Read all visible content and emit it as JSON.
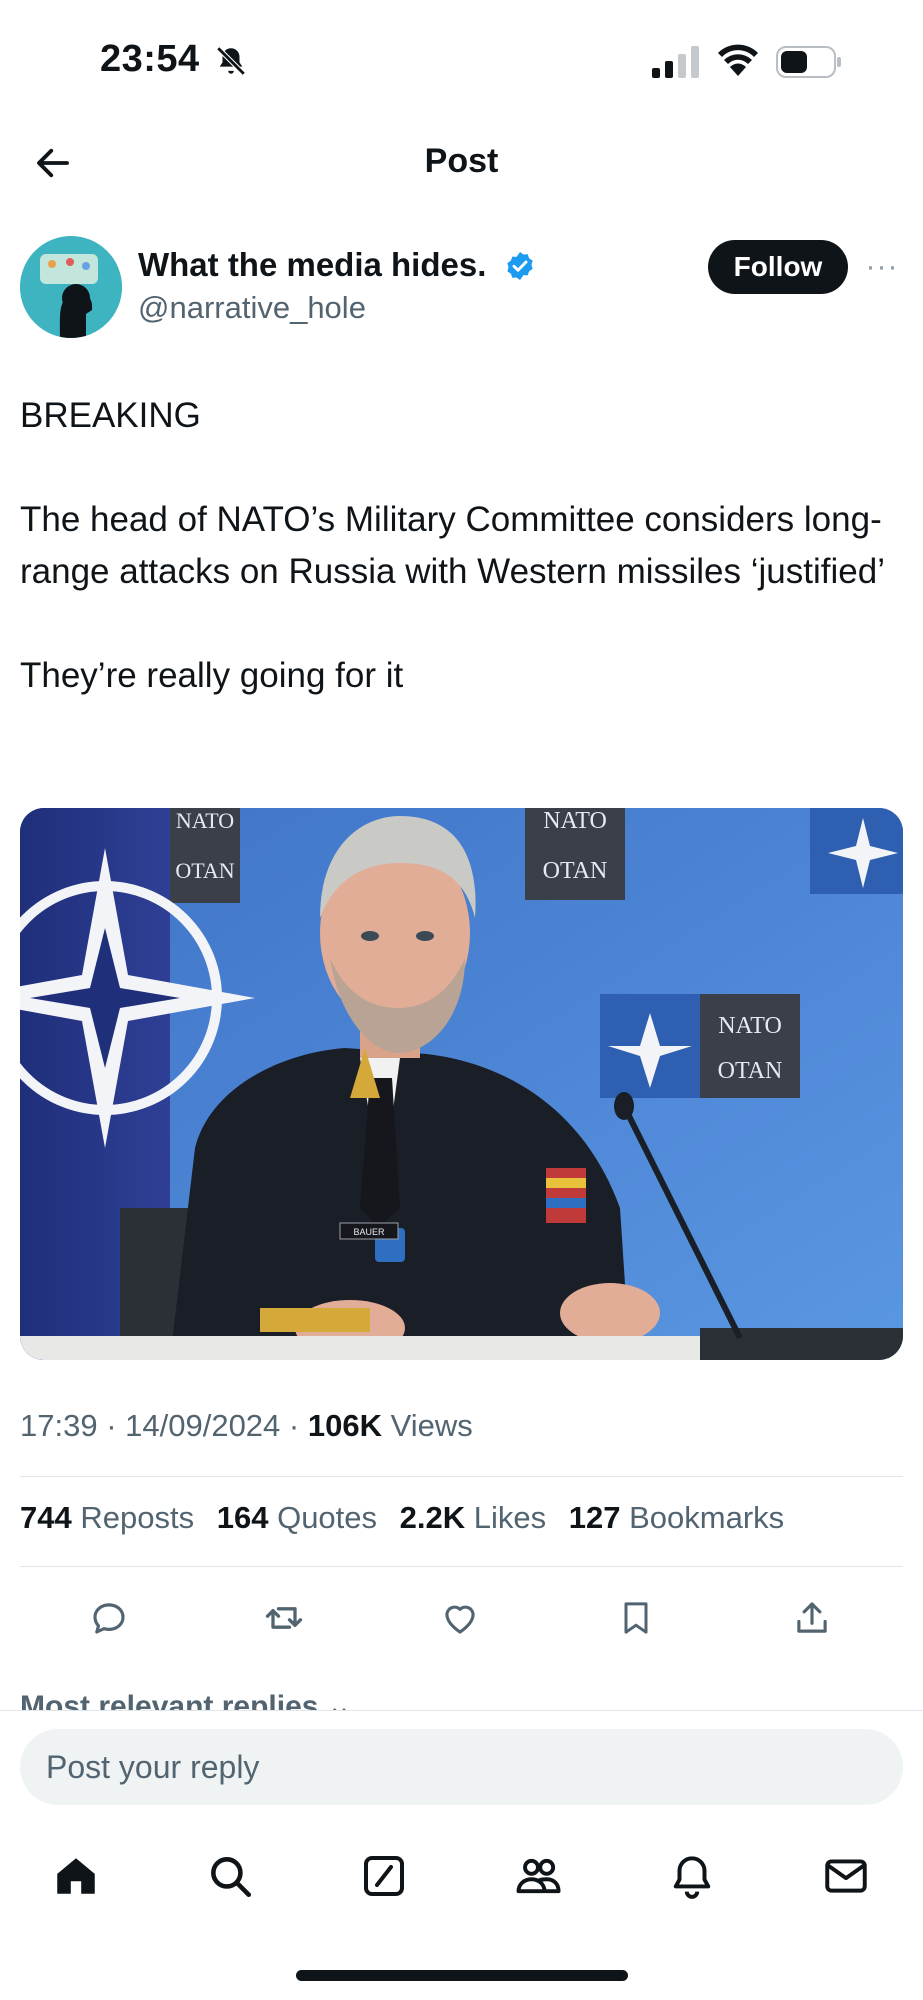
{
  "status_bar": {
    "time": "23:54"
  },
  "header": {
    "title": "Post",
    "back_icon": "arrow-left-icon"
  },
  "author": {
    "display_name": "What the media hides.",
    "handle": "@narrative_hole",
    "verified": true,
    "follow_label": "Follow",
    "more_label": "···"
  },
  "post": {
    "paragraphs": [
      "BREAKING",
      "The head of NATO’s Military Committee considers long-range attacks on Russia with Western missiles ‘justified’",
      "They’re really going for it"
    ],
    "image": {
      "sign_text_1": "NATO",
      "sign_text_2": "OTAN",
      "nameplate": "BAUER"
    }
  },
  "meta": {
    "time": "17:39",
    "date": "14/09/2024",
    "views_count": "106K",
    "views_label": "Views"
  },
  "stats": [
    {
      "count": "744",
      "label": "Reposts"
    },
    {
      "count": "164",
      "label": "Quotes"
    },
    {
      "count": "2.2K",
      "label": "Likes"
    },
    {
      "count": "127",
      "label": "Bookmarks"
    }
  ],
  "actions": [
    "reply-icon",
    "repost-icon",
    "like-icon",
    "bookmark-icon",
    "share-icon"
  ],
  "replies": {
    "sort_label": "Most relevant replies"
  },
  "reply_bar": {
    "placeholder": "Post your reply"
  },
  "tabbar": [
    "home-icon",
    "search-icon",
    "grok-icon",
    "communities-icon",
    "notifications-icon",
    "messages-icon"
  ],
  "colors": {
    "primary_text": "#0f1419",
    "secondary_text": "#536471",
    "verified": "#1d9bf0",
    "media_bg": "#4b86d6"
  }
}
